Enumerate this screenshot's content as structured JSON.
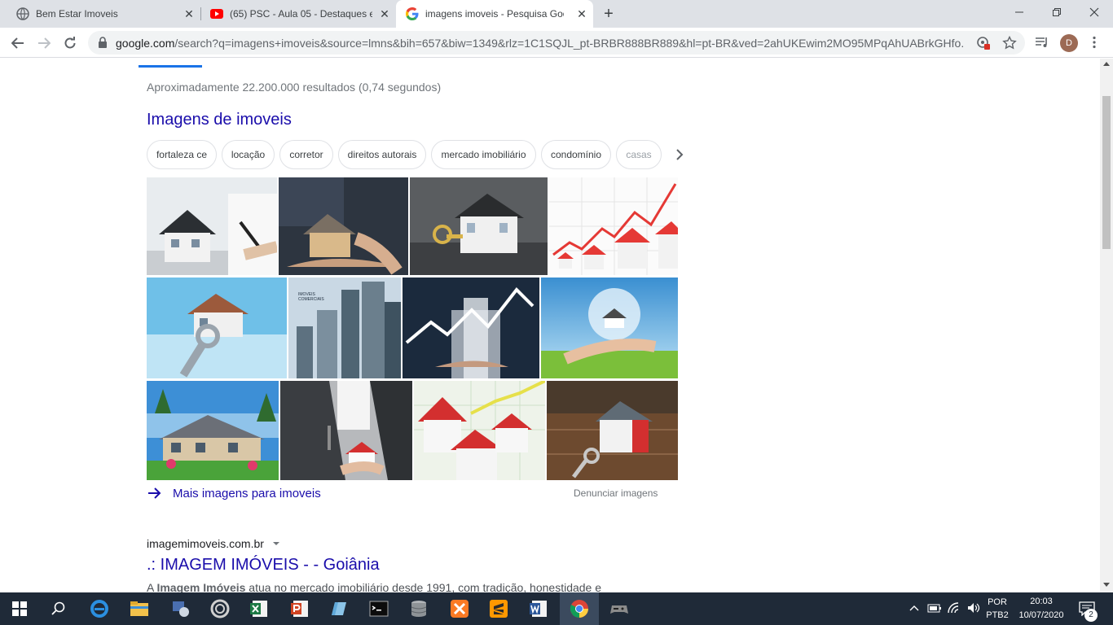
{
  "browser": {
    "tabs": [
      {
        "title": "Bem Estar Imoveis",
        "favicon": "globe-icon"
      },
      {
        "title": "(65) PSC - Aula 05 - Destaques e",
        "favicon": "youtube-icon"
      },
      {
        "title": "imagens imoveis - Pesquisa Goog",
        "favicon": "google-icon"
      }
    ],
    "url_host": "google.com",
    "url_path": "/search?q=imagens+imoveis&source=lmns&bih=657&biw=1349&rlz=1C1SQJL_pt-BRBR888BR889&hl=pt-BR&ved=2ahUKEwim2MO95MPqAhUABrkGHfo...",
    "avatar_letter": "D"
  },
  "page": {
    "stats": "Aproximadamente 22.200.000 resultados (0,74 segundos)",
    "images_heading": "Imagens de imoveis",
    "chips": [
      "fortaleza ce",
      "locação",
      "corretor",
      "direitos autorais",
      "mercado imobiliário",
      "condomínio",
      "casas"
    ],
    "thumbnail_descriptions": [],
    "more_images_label": "Mais imagens para imoveis",
    "report_label": "Denunciar imagens",
    "result": {
      "site": "imagemimoveis.com.br",
      "title": ".: IMAGEM IMÓVEIS - - Goiânia",
      "snippet_prefix": "A ",
      "snippet_bold": "Imagem Imóveis",
      "snippet_rest": " atua no mercado imobiliário desde 1991, com tradição, honestidade e"
    },
    "thumb_overlay_text": [
      "IMOVEIS",
      "COMERCIAIS"
    ]
  },
  "taskbar": {
    "lang_top": "POR",
    "lang_bottom": "PTB2",
    "time": "20:03",
    "date": "10/07/2020",
    "notifications": "2"
  },
  "colors": {
    "link": "#1a0dab",
    "tab_strip": "#dee1e6",
    "taskbar": "#1f2a38",
    "accent_blue": "#1a73e8"
  }
}
